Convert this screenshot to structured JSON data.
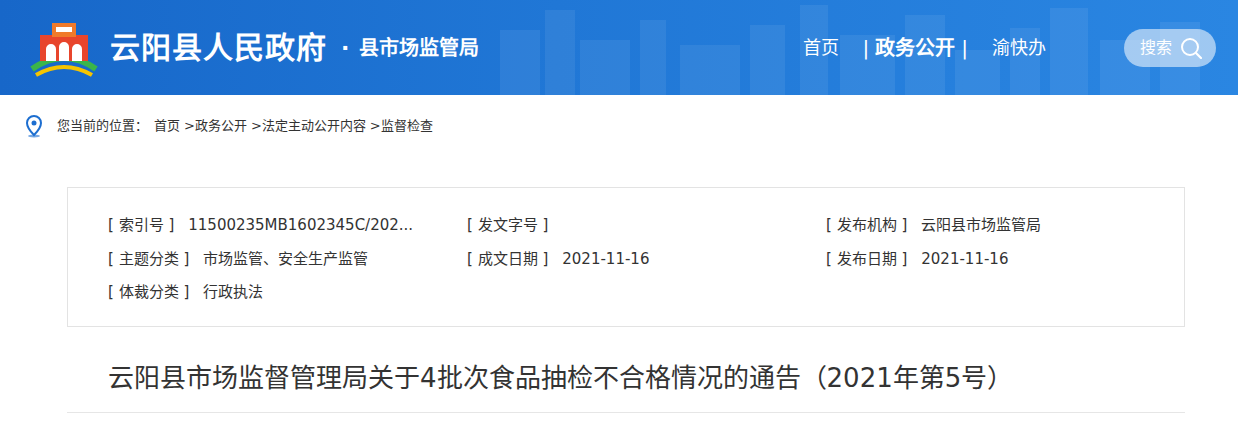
{
  "header": {
    "site_title": "云阳县人民政府",
    "separator": "·",
    "dept": "县市场监管局",
    "nav_divider": "|",
    "nav": [
      {
        "label": "首页",
        "selected": false
      },
      {
        "label": "政务公开",
        "selected": true
      },
      {
        "label": "渝快办",
        "selected": false
      }
    ],
    "search": {
      "label": "搜索"
    }
  },
  "breadcrumb": {
    "prefix": "您当前的位置：",
    "separator": ">",
    "items": [
      "首页",
      "政务公开",
      "法定主动公开内容",
      "监督检查"
    ]
  },
  "info": {
    "rows": [
      [
        {
          "label": "[ 索引号 ]",
          "value": "11500235MB1602345C/202..."
        },
        {
          "label": "[ 发文字号 ]",
          "value": ""
        },
        {
          "label": "[ 发布机构 ]",
          "value": "云阳县市场监管局"
        }
      ],
      [
        {
          "label": "[ 主题分类 ]",
          "value": "市场监管、安全生产监管"
        },
        {
          "label": "[ 成文日期 ]",
          "value": "2021-11-16"
        },
        {
          "label": "[ 发布日期 ]",
          "value": "2021-11-16"
        }
      ],
      [
        {
          "label": "[ 体裁分类 ]",
          "value": "行政执法"
        }
      ]
    ]
  },
  "title": "云阳县市场监督管理局关于4批次食品抽检不合格情况的通告（2021年第5号）"
}
